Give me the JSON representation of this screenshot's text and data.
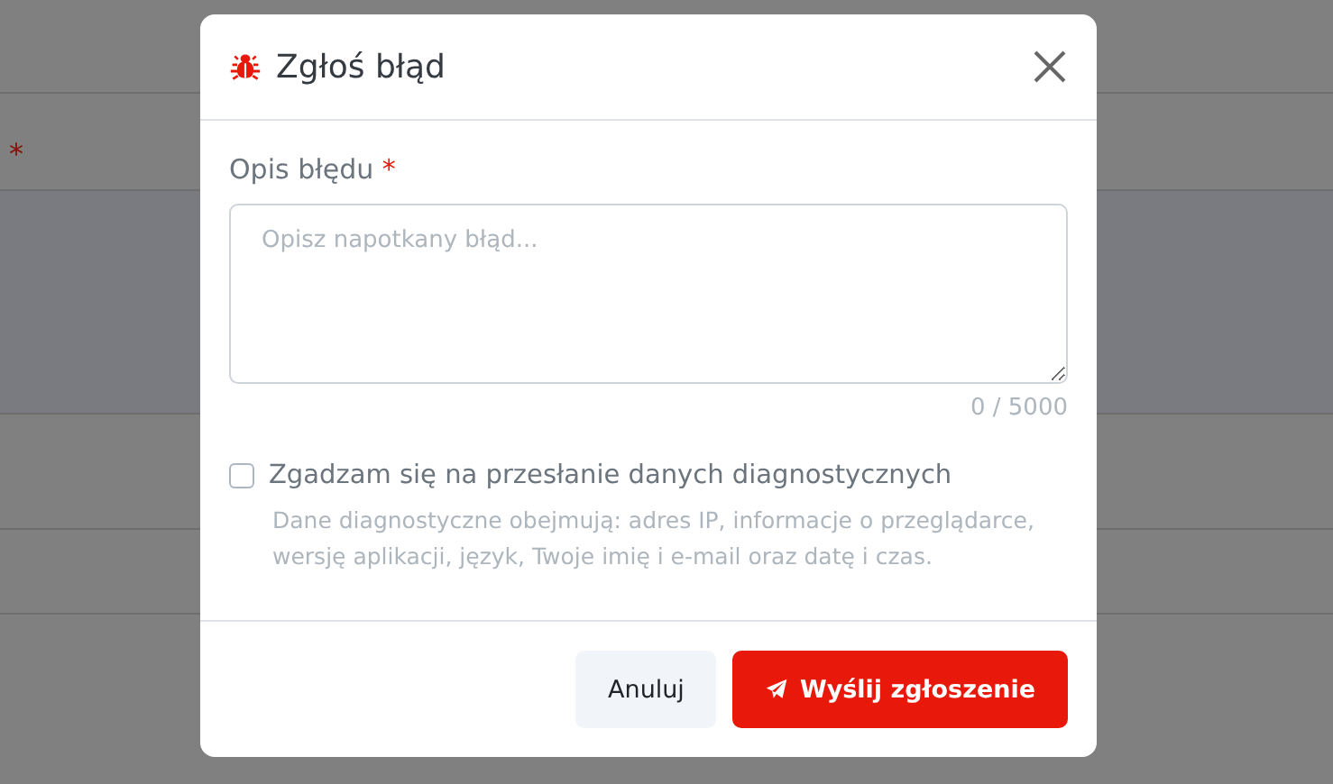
{
  "background": {
    "required_mark": "*"
  },
  "dialog": {
    "title": "Zgłoś błąd",
    "field": {
      "label": "Opis błędu",
      "required_mark": "*",
      "placeholder": "Opisz napotkany błąd...",
      "counter": "0 / 5000"
    },
    "consent": {
      "label": "Zgadzam się na przesłanie danych diagnostycznych",
      "checked": false,
      "help": "Dane diagnostyczne obejmują: adres IP, informacje o przeglądarce, wersję aplikacji, język, Twoje imię i e-mail oraz datę i czas."
    },
    "buttons": [
      {
        "kind": "secondary",
        "label": "Anuluj"
      },
      {
        "kind": "primary",
        "label": "Wyślij zgłoszenie"
      }
    ]
  }
}
